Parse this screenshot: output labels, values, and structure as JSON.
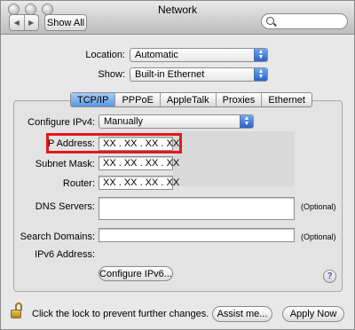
{
  "window": {
    "title": "Network"
  },
  "toolbar": {
    "back_icon": "back-arrow-icon",
    "forward_icon": "forward-arrow-icon",
    "show_all_label": "Show All",
    "search_placeholder": ""
  },
  "location": {
    "label": "Location:",
    "value": "Automatic"
  },
  "show": {
    "label": "Show:",
    "value": "Built-in Ethernet"
  },
  "tabs": [
    {
      "label": "TCP/IP",
      "active": true
    },
    {
      "label": "PPPoE",
      "active": false
    },
    {
      "label": "AppleTalk",
      "active": false
    },
    {
      "label": "Proxies",
      "active": false
    },
    {
      "label": "Ethernet",
      "active": false
    }
  ],
  "tcpip": {
    "configure_ipv4_label": "Configure IPv4:",
    "configure_ipv4_value": "Manually",
    "ip_address_label": "IP Address:",
    "ip_address_value": "XX . XX . XX . XX",
    "subnet_mask_label": "Subnet Mask:",
    "subnet_mask_value": "XX . XX . XX . XX",
    "router_label": "Router:",
    "router_value": "XX . XX . XX . XX",
    "dns_servers_label": "DNS Servers:",
    "dns_optional": "(Optional)",
    "search_domains_label": "Search Domains:",
    "search_domains_optional": "(Optional)",
    "ipv6_address_label": "IPv6 Address:",
    "configure_ipv6_button": "Configure IPv6..."
  },
  "footer": {
    "lock_text": "Click the lock to prevent further changes.",
    "assist_button": "Assist me...",
    "apply_button": "Apply Now"
  },
  "colors": {
    "highlight": "#e4181a",
    "active_tab": "#5a95e1",
    "popup_arrow": "#2b62c6"
  }
}
